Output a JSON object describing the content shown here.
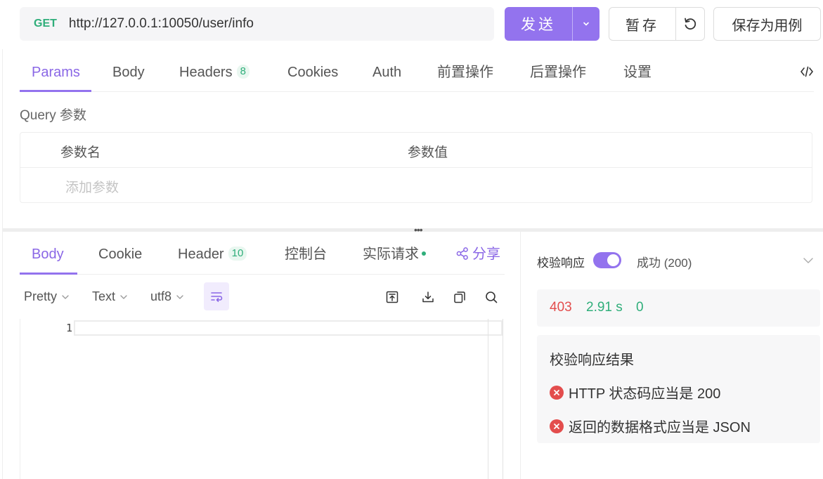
{
  "request": {
    "method": "GET",
    "url": "http://127.0.0.1:10050/user/info",
    "send_label": "发送",
    "stash_label": "暂存",
    "save_case_label": "保存为用例"
  },
  "request_tabs": {
    "params": "Params",
    "body": "Body",
    "headers": "Headers",
    "headers_count": "8",
    "cookies": "Cookies",
    "auth": "Auth",
    "pre": "前置操作",
    "post": "后置操作",
    "settings": "设置"
  },
  "query": {
    "title": "Query 参数",
    "col_name": "参数名",
    "col_value": "参数值",
    "add_placeholder": "添加参数"
  },
  "response_tabs": {
    "body": "Body",
    "cookie": "Cookie",
    "header": "Header",
    "header_count": "10",
    "console": "控制台",
    "actual_request": "实际请求",
    "share": "分享"
  },
  "toolbar": {
    "format": "Pretty",
    "type": "Text",
    "encoding": "utf8"
  },
  "editor": {
    "line_number": "1"
  },
  "validation": {
    "label": "校验响应",
    "status": "成功 (200)",
    "result_title": "校验响应结果",
    "errors": [
      "HTTP 状态码应当是 200",
      "返回的数据格式应当是 JSON"
    ]
  },
  "stats": {
    "status_code": "403",
    "time": "2.91 s",
    "size": "0"
  },
  "colors": {
    "accent": "#9373ee",
    "success": "#2fae7a",
    "error": "#e34d4d"
  }
}
